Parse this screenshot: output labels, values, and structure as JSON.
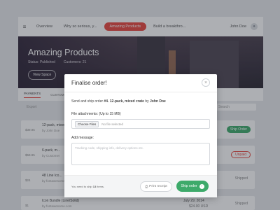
{
  "nav": {
    "items": [
      "Overview",
      "Why so serious, y...",
      "Amazing Products",
      "Build a breakthro..."
    ],
    "user": "John Doe"
  },
  "hero": {
    "title": "Amazing Products",
    "status": "Status: Published",
    "customers": "Customers: 21",
    "button": "View Space"
  },
  "tabs": [
    "PAYMENTS",
    "CUSTOMERS"
  ],
  "toolbar": {
    "export": "Export",
    "search": "Search"
  },
  "orders": [
    {
      "price": "$39.95",
      "title": "12-pack, mixed crate",
      "sub": "by John Doe",
      "date": "",
      "date2": "",
      "status": "Ship Order",
      "status_type": "ship"
    },
    {
      "price": "$59.95",
      "title": "6-pack, m...",
      "sub": "by Customer",
      "date": "",
      "date2": "",
      "status": "Unpaid",
      "status_type": "unpaid"
    },
    {
      "price": "$24",
      "title": "48 Line Ico...",
      "sub": "by fontawesome",
      "date": "",
      "date2": "",
      "status": "Shipped",
      "status_type": "shipped"
    },
    {
      "price": "$1",
      "title": "Icon Bundle (Line/Solid)",
      "sub": "by fontawesome.com",
      "date": "July 29, 2014",
      "date2": "$24.00 USD",
      "status": "Shipped",
      "status_type": "shipped"
    }
  ],
  "modal": {
    "title": "Finalise order!",
    "desc_prefix": "Send and ship order ",
    "desc_order": "#4. 12-pack, mixed crate",
    "desc_mid": " by ",
    "desc_customer": "John Doe",
    "attach_label": "File attachments: (Up to 15 MB)",
    "choose_files": "Choose Files",
    "no_file": "No file selected",
    "message_label": "Add message:",
    "message_placeholder": "Tracking code, shipping info, delivery options etc.",
    "note_prefix": "You need to ship ",
    "note_count": "13",
    "note_suffix": " items.",
    "print_label": "Print receipt",
    "ship_label": "Ship order"
  },
  "colors": {
    "accent": "#e8453c",
    "success": "#3daa6a"
  }
}
